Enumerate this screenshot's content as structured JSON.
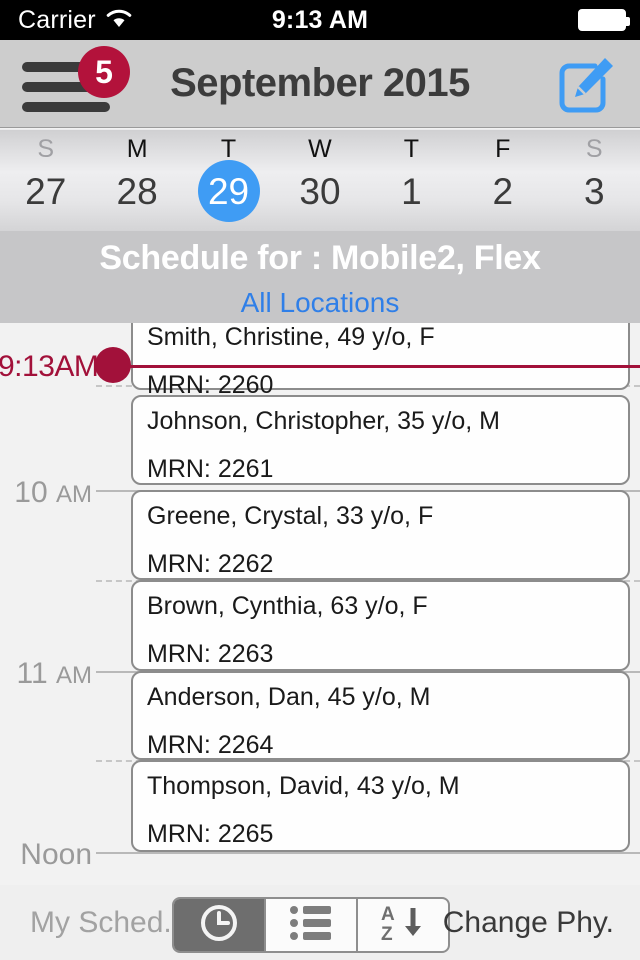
{
  "status_bar": {
    "carrier": "Carrier",
    "wifi_icon": "wifi-icon",
    "time": "9:13 AM",
    "battery_icon": "battery-full-icon"
  },
  "nav_bar": {
    "menu_icon": "hamburger-menu-icon",
    "badge_count": "5",
    "title": "September 2015",
    "compose_icon": "compose-edit-icon"
  },
  "week_strip": {
    "days": [
      {
        "dow": "S",
        "num": "27",
        "weekend": true,
        "selected": false
      },
      {
        "dow": "M",
        "num": "28",
        "weekend": false,
        "selected": false
      },
      {
        "dow": "T",
        "num": "29",
        "weekend": false,
        "selected": true
      },
      {
        "dow": "W",
        "num": "30",
        "weekend": false,
        "selected": false
      },
      {
        "dow": "T",
        "num": "1",
        "weekend": false,
        "selected": false
      },
      {
        "dow": "F",
        "num": "2",
        "weekend": false,
        "selected": false
      },
      {
        "dow": "S",
        "num": "3",
        "weekend": true,
        "selected": false
      }
    ],
    "selected_color": "#3f9cf4"
  },
  "schedule_header": {
    "title": "Schedule for : Mobile2, Flex",
    "location_filter": "All Locations",
    "link_color": "#2f7fe8"
  },
  "agenda": {
    "now_indicator": {
      "time": "9:13AM",
      "color": "#a2113a"
    },
    "hour_labels": [
      {
        "hour": "10",
        "suffix": "AM"
      },
      {
        "hour": "11",
        "suffix": "AM"
      },
      {
        "hour": "Noon",
        "suffix": ""
      }
    ],
    "appointments": [
      {
        "name": "Smith, Christine, 49 y/o, F",
        "mrn": "MRN: 2260"
      },
      {
        "name": "Johnson, Christopher, 35 y/o, M",
        "mrn": "MRN: 2261"
      },
      {
        "name": "Greene, Crystal, 33 y/o, F",
        "mrn": "MRN: 2262"
      },
      {
        "name": "Brown, Cynthia, 63 y/o, F",
        "mrn": "MRN: 2263"
      },
      {
        "name": "Anderson, Dan, 45 y/o, M",
        "mrn": "MRN: 2264"
      },
      {
        "name": "Thompson, David, 43 y/o, M",
        "mrn": "MRN: 2265"
      }
    ]
  },
  "toolbar": {
    "my_schedule_label": "My Sched.",
    "change_physician_label": "Change Phy.",
    "segments": [
      {
        "icon": "clock-icon",
        "selected": true
      },
      {
        "icon": "list-icon",
        "selected": false
      },
      {
        "icon": "sort-az-icon",
        "selected": false
      }
    ]
  }
}
